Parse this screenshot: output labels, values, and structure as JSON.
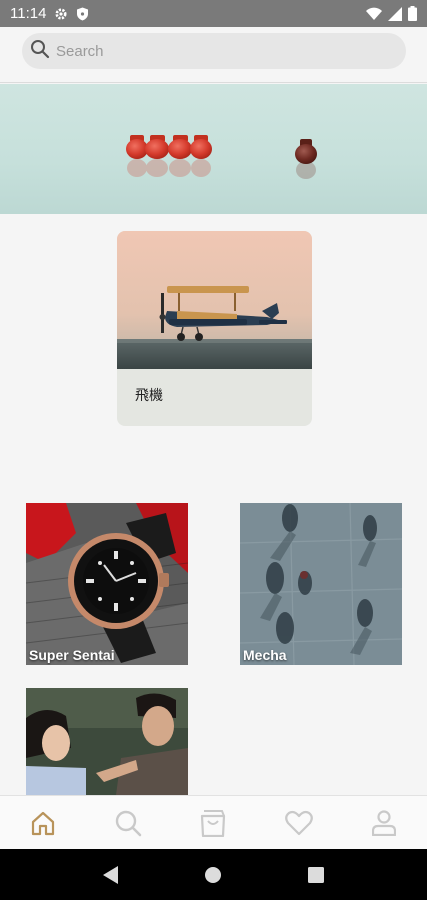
{
  "status_bar": {
    "time": "11:14",
    "icons": [
      "gear-icon",
      "shield-icon",
      "wifi-icon",
      "signal-icon",
      "battery-icon"
    ]
  },
  "search": {
    "placeholder": "Search"
  },
  "featured": {
    "label": "飛機"
  },
  "tiles": [
    {
      "label": "Super Sentai"
    },
    {
      "label": "Mecha"
    },
    {
      "label": ""
    }
  ],
  "bottom_nav": {
    "items": [
      "home-icon",
      "search-icon",
      "bag-icon",
      "heart-icon",
      "profile-icon"
    ],
    "active": "home-icon",
    "active_color": "#b8935a",
    "inactive_color": "#c9c9c9"
  },
  "system_nav": [
    "back-icon",
    "home-circle-icon",
    "recents-icon"
  ]
}
